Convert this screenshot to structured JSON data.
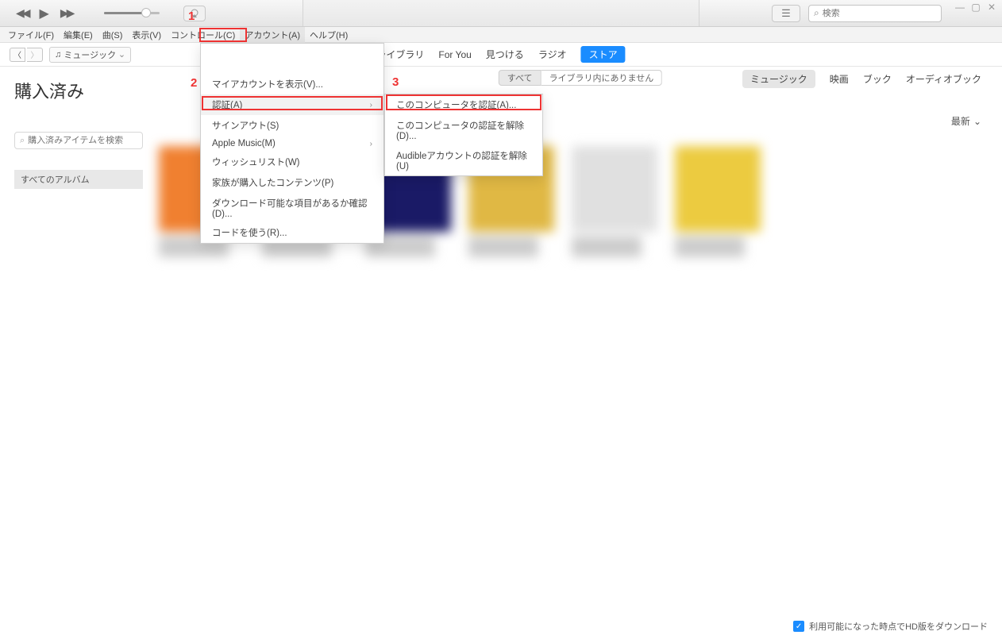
{
  "search": {
    "placeholder": "検索"
  },
  "menubar": {
    "items": [
      "ファイル(F)",
      "編集(E)",
      "曲(S)",
      "表示(V)",
      "コントロール(C)",
      "アカウント(A)",
      "ヘルプ(H)"
    ]
  },
  "mediaSelect": {
    "icon": "♫",
    "label": "ミュージック"
  },
  "centerTabs": [
    "ライブラリ",
    "For You",
    "見つける",
    "ラジオ",
    "ストア"
  ],
  "page": {
    "title": "購入済み",
    "filterPlaceholder": "購入済みアイテムを検索",
    "albumFilter": "すべてのアルバム"
  },
  "subTabs": [
    "すべて",
    "ライブラリ内にありません"
  ],
  "categories": [
    "ミュージック",
    "映画",
    "ブック",
    "オーディオブック"
  ],
  "sort": {
    "label": "最新"
  },
  "accountMenu": {
    "items": [
      {
        "label": "マイアカウントを表示(V)..."
      },
      {
        "label": "認証(A)",
        "submenu": true,
        "hover": true
      },
      {
        "label": "サインアウト(S)"
      },
      {
        "label": "Apple Music(M)",
        "submenu": true,
        "sep": true
      },
      {
        "label": "ウィッシュリスト(W)",
        "sep": true
      },
      {
        "label": "家族が購入したコンテンツ(P)"
      },
      {
        "label": "ダウンロード可能な項目があるか確認(D)..."
      },
      {
        "label": "コードを使う(R)...",
        "sep": true
      }
    ]
  },
  "submenu": {
    "items": [
      {
        "label": "このコンピュータを認証(A)..."
      },
      {
        "label": "このコンピュータの認証を解除(D)..."
      },
      {
        "label": "Audibleアカウントの認証を解除(U)"
      }
    ]
  },
  "bottom": {
    "label": "利用可能になった時点でHD版をダウンロード"
  },
  "annotations": {
    "n1": "1",
    "n2": "2",
    "n3": "3"
  }
}
